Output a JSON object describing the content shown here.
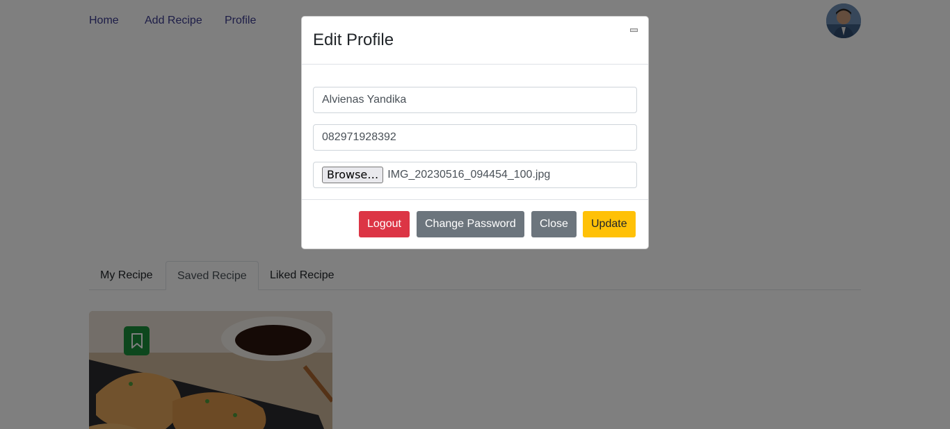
{
  "nav": {
    "home": "Home",
    "add_recipe": "Add Recipe",
    "profile": "Profile"
  },
  "tabs": [
    {
      "label": "My Recipe",
      "active": false
    },
    {
      "label": "Saved Recipe",
      "active": true
    },
    {
      "label": "Liked Recipe",
      "active": false
    }
  ],
  "card": {
    "bookmark_icon": "bookmark-icon"
  },
  "modal": {
    "title": "Edit Profile",
    "name_value": "Alvienas Yandika",
    "phone_value": "082971928392",
    "browse_label": "Browse…",
    "file_name": "IMG_20230516_094454_100.jpg",
    "buttons": {
      "logout": "Logout",
      "change_password": "Change Password",
      "close": "Close",
      "update": "Update"
    }
  },
  "colors": {
    "danger": "#dc3545",
    "secondary": "#6c757d",
    "warning": "#ffc107",
    "bookmark": "#1b8f3a"
  }
}
